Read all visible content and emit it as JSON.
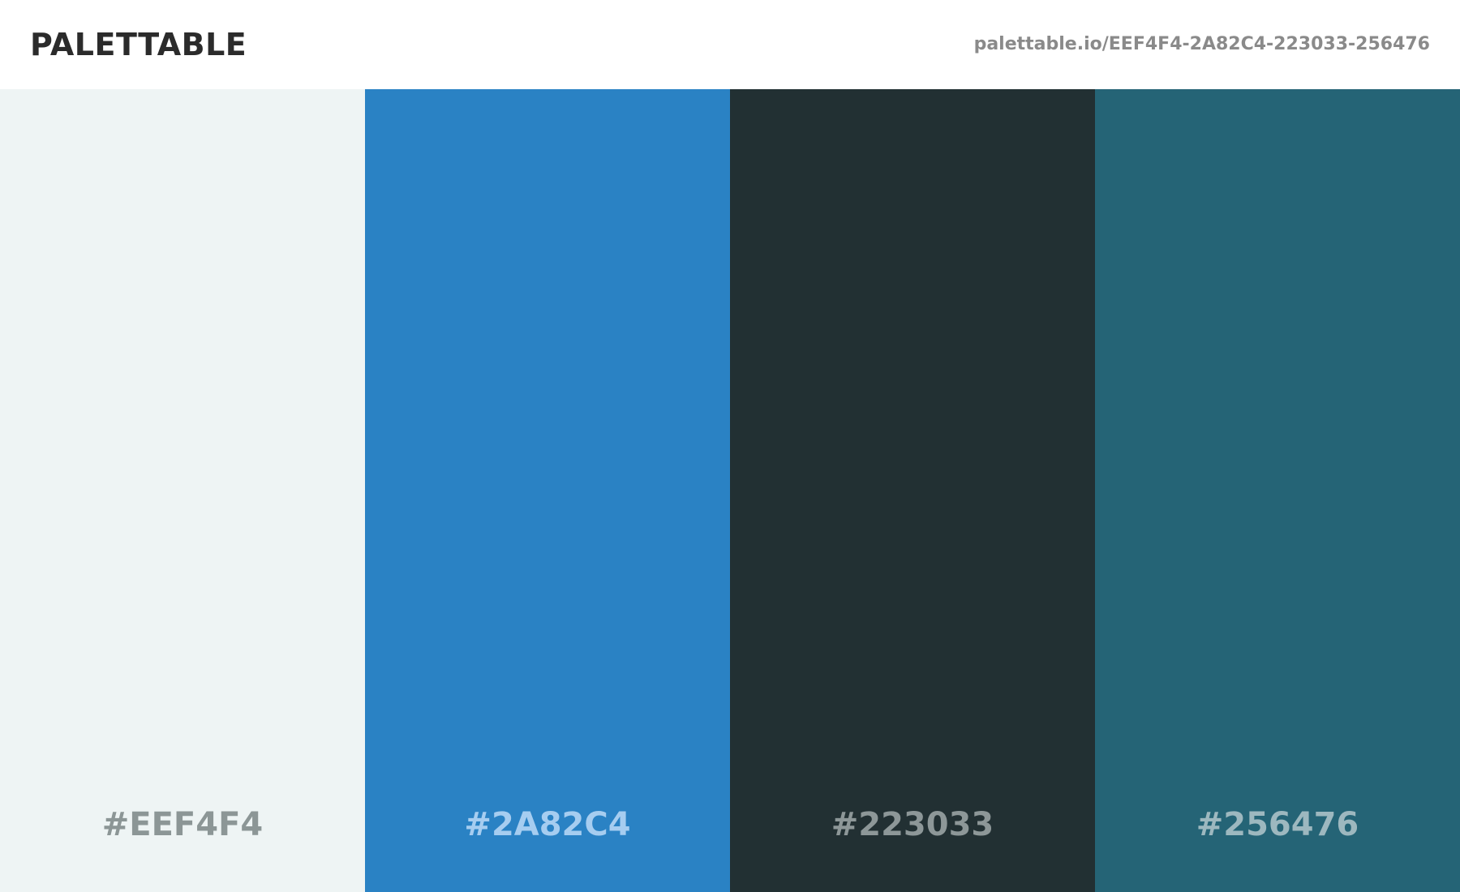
{
  "header": {
    "brand": "PALETTABLE",
    "url": "palettable.io/EEF4F4-2A82C4-223033-256476"
  },
  "swatches": [
    {
      "hex": "#EEF4F4",
      "color": "#EEF4F4",
      "label_color": "#8c9696"
    },
    {
      "hex": "#2A82C4",
      "color": "#2A82C4",
      "label_color": "#a6cdf0"
    },
    {
      "hex": "#223033",
      "color": "#223033",
      "label_color": "#8d9798"
    },
    {
      "hex": "#256476",
      "color": "#256476",
      "label_color": "#9db8bf"
    }
  ]
}
